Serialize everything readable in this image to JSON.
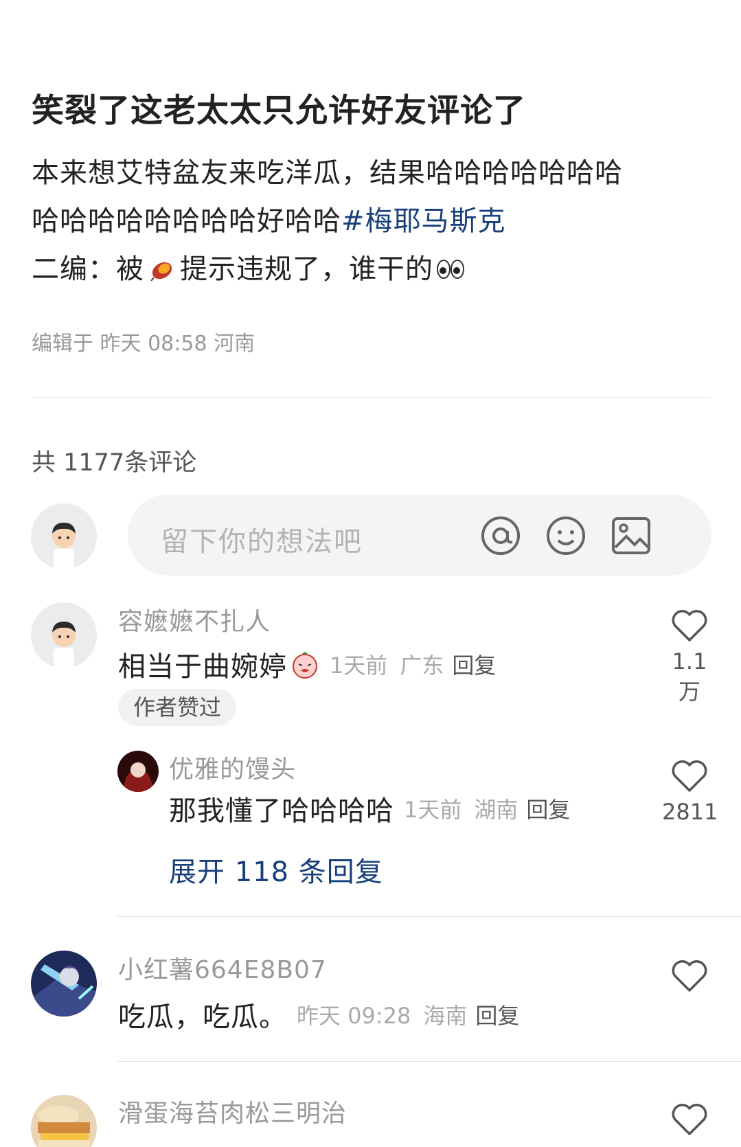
{
  "post": {
    "title": "笑裂了这老太太只允许好友评论了",
    "body_line1": "本来想艾特盆友来吃洋瓜，结果哈哈哈哈哈哈哈",
    "body_line2": "哈哈哈哈哈哈哈哈好哈哈",
    "hashtag": "#梅耶马斯克",
    "edit_prefix": "二编：被",
    "edit_emoji_icon": "sweet-potato-icon",
    "edit_suffix": "提示违规了，谁干的",
    "edit_end_icon": "eyes-icon",
    "meta": "编辑于 昨天 08:58 河南"
  },
  "comments_header": {
    "count_text": "共 1177条评论"
  },
  "comment_input": {
    "placeholder": "留下你的想法吧",
    "icons": [
      "at-icon",
      "smile-icon",
      "image-icon"
    ]
  },
  "comments": [
    {
      "author": "容嬷嬷不扎人",
      "text": "相当于曲婉婷",
      "emoji_icon": "peach-face-emoji",
      "time": "1天前",
      "location": "广东",
      "reply_label": "回复",
      "badge": "作者赞过",
      "likes": "1.1万",
      "replies": [
        {
          "author": "优雅的馒头",
          "text": "那我懂了哈哈哈哈",
          "time": "1天前",
          "location": "湖南",
          "reply_label": "回复",
          "likes": "2811"
        }
      ],
      "expand_label": "展开 118 条回复"
    },
    {
      "author": "小红薯664E8B07",
      "text": "吃瓜，吃瓜。",
      "time": "昨天 09:28",
      "location": "海南",
      "reply_label": "回复",
      "likes": ""
    },
    {
      "author": "滑蛋海苔肉松三明治",
      "likes": ""
    }
  ],
  "colors": {
    "link": "#173f7a",
    "muted": "#999999",
    "input_bg": "#f4f4f4"
  }
}
